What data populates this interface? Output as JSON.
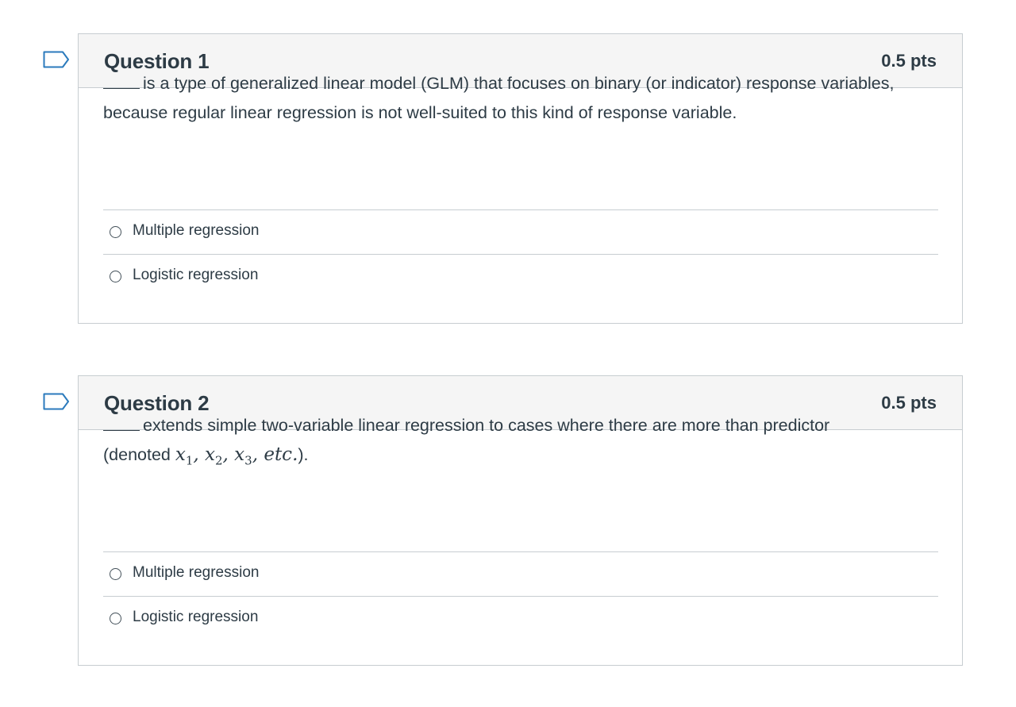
{
  "questions": [
    {
      "title": "Question 1",
      "points": "0.5 pts",
      "text_after_blank": "is a type of generalized linear model (GLM) that focuses on binary (or indicator) response variables, because regular linear regression is not well-suited to this kind of response variable.",
      "answers": [
        {
          "label": "Multiple regression"
        },
        {
          "label": "Logistic regression"
        }
      ]
    },
    {
      "title": "Question 2",
      "points": "0.5 pts",
      "text_after_blank": "extends simple two-variable linear regression to cases where there are more than predictor",
      "text_line2_prefix": "(denoted ",
      "math_vars": [
        "x",
        "x",
        "x"
      ],
      "math_subs": [
        "1",
        "2",
        "3"
      ],
      "math_sep": ", ",
      "math_etc": "etc.",
      "text_line2_suffix": ").",
      "answers": [
        {
          "label": "Multiple regression"
        },
        {
          "label": "Logistic regression"
        }
      ]
    }
  ]
}
